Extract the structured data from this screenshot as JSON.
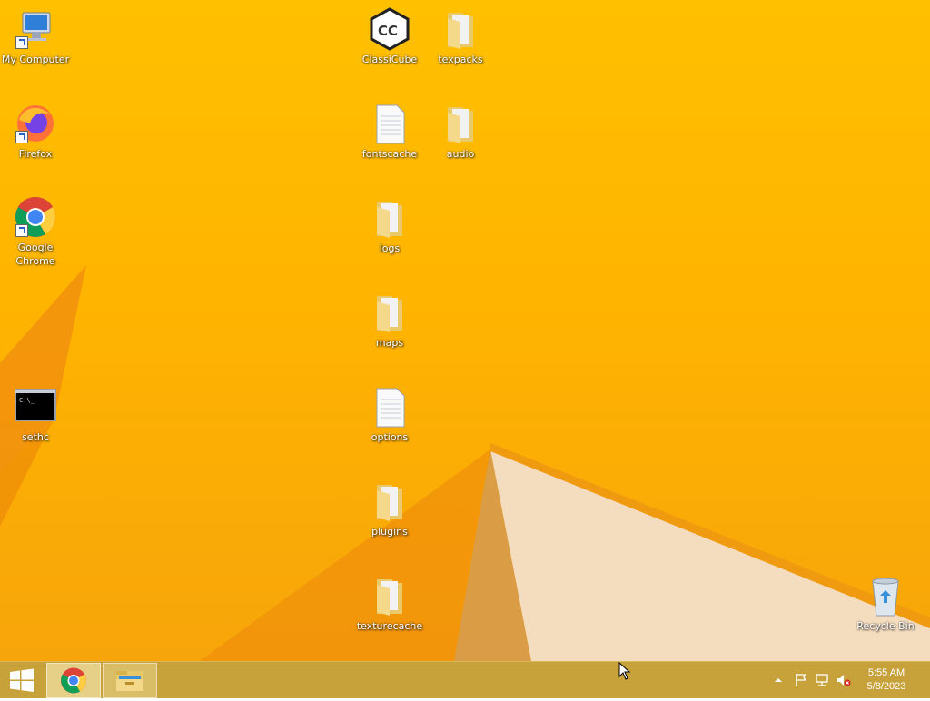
{
  "desktop": {
    "icons": [
      {
        "label": "My Computer",
        "icon": "my-computer-icon"
      },
      {
        "label": "Firefox",
        "icon": "firefox-icon"
      },
      {
        "label": "Google Chrome",
        "icon": "chrome-icon"
      },
      {
        "label": "sethc",
        "icon": "console-icon"
      },
      {
        "label": "ClassiCube",
        "icon": "classicube-icon"
      },
      {
        "label": "texpacks",
        "icon": "folder-icon"
      },
      {
        "label": "fontscache",
        "icon": "file-icon"
      },
      {
        "label": "audio",
        "icon": "folder-icon"
      },
      {
        "label": "logs",
        "icon": "folder-icon"
      },
      {
        "label": "maps",
        "icon": "folder-icon"
      },
      {
        "label": "options",
        "icon": "file-icon"
      },
      {
        "label": "plugins",
        "icon": "folder-icon"
      },
      {
        "label": "texturecache",
        "icon": "folder-icon"
      },
      {
        "label": "Recycle Bin",
        "icon": "recycle-bin-icon"
      }
    ]
  },
  "taskbar": {
    "start": "windows-logo-icon",
    "pinned": [
      "chrome-icon",
      "file-explorer-icon"
    ],
    "tray": [
      "show-hidden-icons-icon",
      "action-center-flag-icon",
      "network-icon",
      "volume-muted-icon"
    ],
    "time": "5:55 AM",
    "date": "5/8/2023"
  },
  "colors": {
    "wallpaper": "#ffb400",
    "taskbar": "#c7a23a"
  }
}
